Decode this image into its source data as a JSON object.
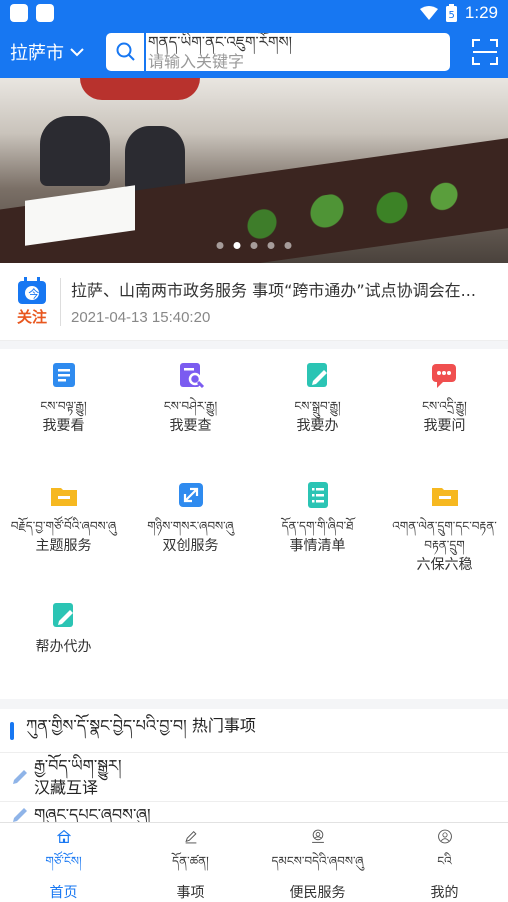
{
  "status": {
    "time": "1:29"
  },
  "header": {
    "city": "拉萨市",
    "search_tibetan": "གནད་ཡིག་ནང་འཇུག་རོགས།",
    "search_placeholder": "请输入关键字"
  },
  "banner": {
    "slides": 5,
    "active_index": 1
  },
  "news": {
    "badge_label": "关注",
    "title": "拉萨、山南两市政务服务 事项“跨市通办”试点协调会在...",
    "time": "2021-04-13 15:40:20"
  },
  "grid": [
    {
      "tb": "ངས་བལྟ་རྒྱུ།",
      "cn": "我要看",
      "icon": "document-icon",
      "color": "#2f8bef"
    },
    {
      "tb": "ངས་བཤེར་རྒྱུ།",
      "cn": "我要查",
      "icon": "search-doc-icon",
      "color": "#7b5cf0"
    },
    {
      "tb": "ངས་སྒྲུབ་རྒྱུ།",
      "cn": "我要办",
      "icon": "edit-doc-icon",
      "color": "#2bc4b4"
    },
    {
      "tb": "ངས་འདྲི་རྒྱུ།",
      "cn": "我要问",
      "icon": "chat-icon",
      "color": "#f04f4f"
    },
    {
      "tb": "བརྗོད་བྱ་གཙོ་བོའི་ཞབས་ཞུ",
      "cn": "主题服务",
      "icon": "folder-icon",
      "color": "#f6b820"
    },
    {
      "tb": "གཉིས་གསར་ཞབས་ཞུ",
      "cn": "双创服务",
      "icon": "expand-icon",
      "color": "#2f8bef"
    },
    {
      "tb": "དོན་དག་གི་ཞིབ་ཐོ",
      "cn": "事情清单",
      "icon": "list-icon",
      "color": "#2bc4b4"
    },
    {
      "tb": "འགན་ལེན་དྲུག་དང་བརྟན་བརྟན་དྲུག",
      "cn": "六保六稳",
      "icon": "folder-icon",
      "color": "#f6b820"
    },
    {
      "tb": "",
      "cn": "帮办代办",
      "icon": "edit-doc-icon",
      "color": "#2bc4b4"
    }
  ],
  "hot": {
    "title": "ཀུན་གྱིས་དོ་སྣང་བྱེད་པའི་བྱ་བ། 热门事项",
    "items": [
      {
        "tb": "རྒྱ་བོད་ཡིག་སྒྱུར།",
        "cn": "汉藏互译"
      },
      {
        "tb": "གཞུང་དཔང་ཞབས་ཞུ།",
        "cn": ""
      }
    ]
  },
  "tabs": [
    {
      "tb": "གཙོ་ངོས།",
      "cn": "首页",
      "icon": "home-icon"
    },
    {
      "tb": "དོན་ཚན།",
      "cn": "事项",
      "icon": "pen-icon"
    },
    {
      "tb": "དམངས་བདེའི་ཞབས་ཞུ",
      "cn": "便民服务",
      "icon": "location-icon"
    },
    {
      "tb": "ངའི",
      "cn": "我的",
      "icon": "user-icon"
    }
  ],
  "colors": {
    "primary": "#1777f2",
    "badge": "#e8571f"
  }
}
